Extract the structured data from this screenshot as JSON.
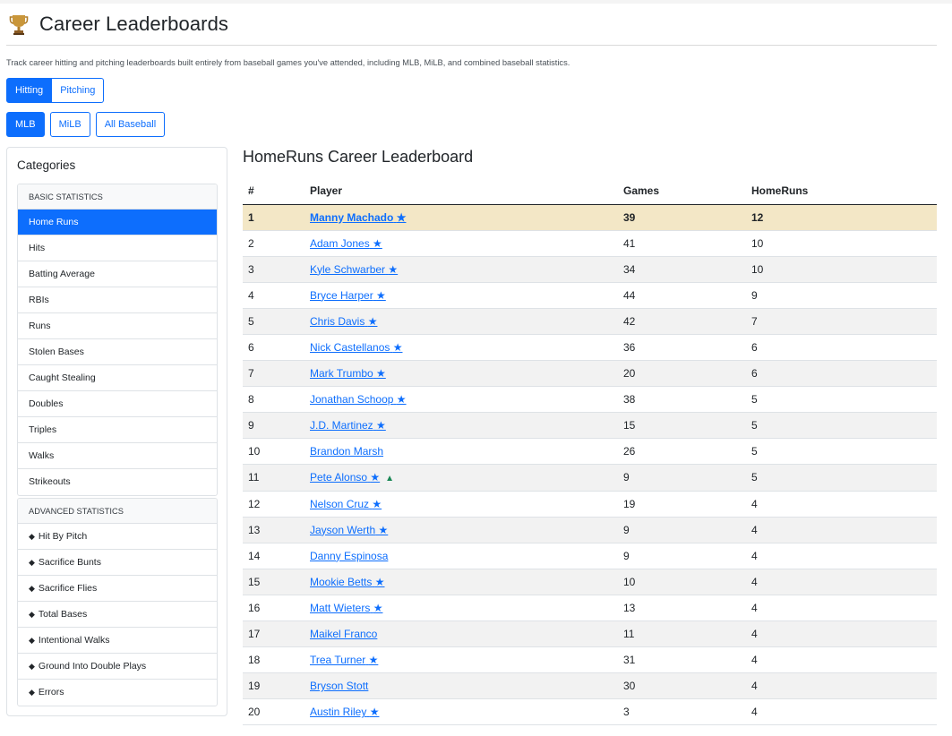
{
  "page": {
    "title": "Career Leaderboards",
    "description": "Track career hitting and pitching leaderboards built entirely from baseball games you've attended, including MLB, MiLB, and combined baseball statistics.",
    "icon": "trophy-icon"
  },
  "stat_type_tabs": [
    {
      "label": "Hitting",
      "active": true
    },
    {
      "label": "Pitching",
      "active": false
    }
  ],
  "league_tabs": [
    {
      "label": "MLB",
      "active": true
    },
    {
      "label": "MiLB",
      "active": false
    },
    {
      "label": "All Baseball",
      "active": false
    }
  ],
  "sidebar": {
    "title": "Categories",
    "basic": {
      "header": "Basic Statistics",
      "items": [
        "Home Runs",
        "Hits",
        "Batting Average",
        "RBIs",
        "Runs",
        "Stolen Bases",
        "Caught Stealing",
        "Doubles",
        "Triples",
        "Walks",
        "Strikeouts"
      ],
      "active_index": 0
    },
    "advanced": {
      "header": "Advanced Statistics",
      "marker": "◆",
      "items": [
        "Hit By Pitch",
        "Sacrifice Bunts",
        "Sacrifice Flies",
        "Total Bases",
        "Intentional Walks",
        "Ground Into Double Plays",
        "Errors"
      ]
    }
  },
  "leaderboard": {
    "title": "HomeRuns Career Leaderboard",
    "columns": [
      "#",
      "Player",
      "Games",
      "HomeRuns"
    ],
    "star": "★",
    "rows": [
      {
        "rank": "1",
        "player": "Manny Machado",
        "star": true,
        "games": "39",
        "value": "12"
      },
      {
        "rank": "2",
        "player": "Adam Jones",
        "star": true,
        "games": "41",
        "value": "10"
      },
      {
        "rank": "3",
        "player": "Kyle Schwarber",
        "star": true,
        "games": "34",
        "value": "10"
      },
      {
        "rank": "4",
        "player": "Bryce Harper",
        "star": true,
        "games": "44",
        "value": "9"
      },
      {
        "rank": "5",
        "player": "Chris Davis",
        "star": true,
        "games": "42",
        "value": "7"
      },
      {
        "rank": "6",
        "player": "Nick Castellanos",
        "star": true,
        "games": "36",
        "value": "6"
      },
      {
        "rank": "7",
        "player": "Mark Trumbo",
        "star": true,
        "games": "20",
        "value": "6"
      },
      {
        "rank": "8",
        "player": "Jonathan Schoop",
        "star": true,
        "games": "38",
        "value": "5"
      },
      {
        "rank": "9",
        "player": "J.D. Martinez",
        "star": true,
        "games": "15",
        "value": "5"
      },
      {
        "rank": "10",
        "player": "Brandon Marsh",
        "star": false,
        "games": "26",
        "value": "5"
      },
      {
        "rank": "11",
        "player": "Pete Alonso",
        "star": true,
        "trend_up": true,
        "games": "9",
        "value": "5"
      },
      {
        "rank": "12",
        "player": "Nelson Cruz",
        "star": true,
        "games": "19",
        "value": "4"
      },
      {
        "rank": "13",
        "player": "Jayson Werth",
        "star": true,
        "games": "9",
        "value": "4"
      },
      {
        "rank": "14",
        "player": "Danny Espinosa",
        "star": false,
        "games": "9",
        "value": "4"
      },
      {
        "rank": "15",
        "player": "Mookie Betts",
        "star": true,
        "games": "10",
        "value": "4"
      },
      {
        "rank": "16",
        "player": "Matt Wieters",
        "star": true,
        "games": "13",
        "value": "4"
      },
      {
        "rank": "17",
        "player": "Maikel Franco",
        "star": false,
        "games": "11",
        "value": "4"
      },
      {
        "rank": "18",
        "player": "Trea Turner",
        "star": true,
        "games": "31",
        "value": "4"
      },
      {
        "rank": "19",
        "player": "Bryson Stott",
        "star": false,
        "games": "30",
        "value": "4"
      },
      {
        "rank": "20",
        "player": "Austin Riley",
        "star": true,
        "games": "3",
        "value": "4"
      }
    ]
  },
  "colors": {
    "accent": "#0d6efd",
    "highlight_row": "#f3e7c6",
    "trend_up": "#198754"
  }
}
